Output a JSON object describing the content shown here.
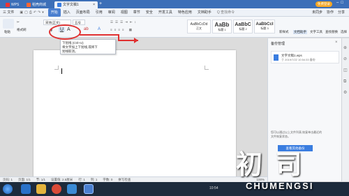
{
  "titlebar": {
    "tabs": [
      "WPS",
      "稻壳商城",
      "文字文稿1"
    ],
    "right_badge": "免费登录"
  },
  "menubar": {
    "file": "三 文件",
    "items": [
      "开始",
      "插入",
      "页面布局",
      "引用",
      "审阅",
      "视图",
      "章节",
      "安全",
      "开发工具",
      "特色应用",
      "文档助手"
    ],
    "search": "Q 查找命令",
    "right": [
      "未同步",
      "协作",
      "分享"
    ]
  },
  "ribbon": {
    "paste": "粘贴",
    "format_painter": "格式刷",
    "font_name": "宋体(正文)",
    "font_size": "五号",
    "styles": [
      {
        "preview": "AaBbCcDd",
        "label": "正文"
      },
      {
        "preview": "AaBb",
        "label": "标题 1"
      },
      {
        "preview": "AaBbC",
        "label": "标题 2"
      },
      {
        "preview": "AaBbCcI",
        "label": "标题 3"
      }
    ],
    "right_tools": [
      "新样式",
      "文档助手",
      "文字工具",
      "查找替换",
      "选择"
    ]
  },
  "tooltip": {
    "title": "下划线 (Ctrl+U)",
    "line1": "将文字加上下划线,或将下",
    "line2": "划线取消。"
  },
  "sidepanel": {
    "title": "备份管理",
    "file_name": "文字文稿1.wps",
    "file_time": "于 2019/7/22 10:54:33 备份",
    "tip_line1": "您可以通过以上文件列表,恢复单击最近的",
    "tip_line2": "文件恢复状态。",
    "button": "查看其他备份"
  },
  "statusbar": {
    "items": [
      "页码: 1",
      "页面: 1/1",
      "节: 1/1",
      "设置值: 2.5厘米",
      "行: 1",
      "列: 1",
      "字数: 0",
      "拼写检查"
    ],
    "zoom": "100%"
  },
  "taskbar": {
    "time": "10:54"
  },
  "watermark": {
    "cn": "初  司",
    "en": "CHUMENGSI"
  },
  "colors": {
    "title_blue": "#3c6fb8",
    "accent": "#4a7fd0",
    "annotation_red": "#e03030"
  }
}
